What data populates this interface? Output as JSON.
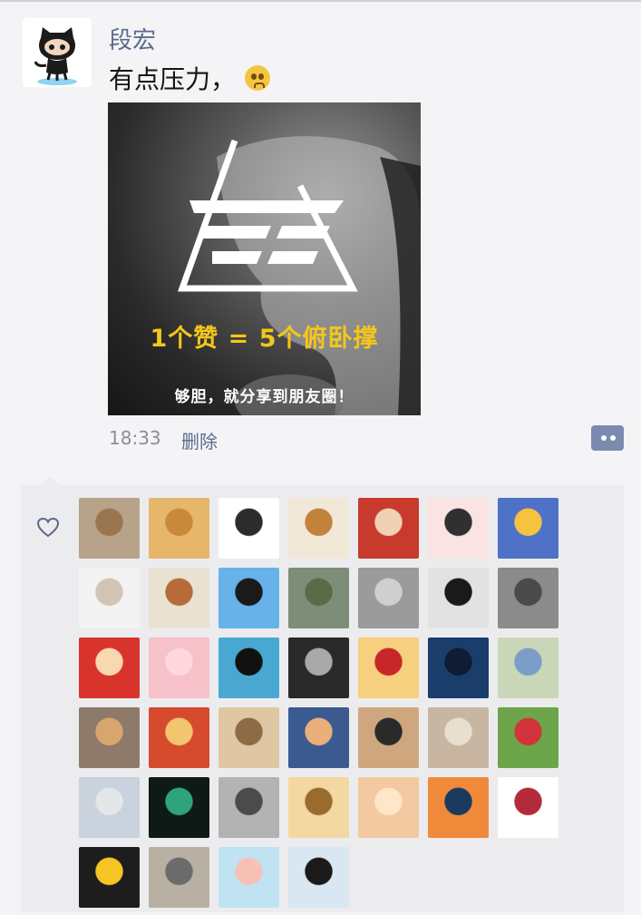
{
  "post": {
    "author": "段宏",
    "text": "有点压力，",
    "image": {
      "headline": "1个赞 = 5个俯卧撑",
      "caption": "够胆，就分享到朋友圈！"
    },
    "time": "18:33",
    "delete_label": "删除"
  },
  "likes": {
    "count": 40,
    "avatars": [
      [
        "#b7a28a",
        "#9a7650"
      ],
      [
        "#e6b66a",
        "#c9893b"
      ],
      [
        "#ffffff",
        "#2c2c2c"
      ],
      [
        "#f2e8d8",
        "#c1823c"
      ],
      [
        "#c83a2c",
        "#f0d1b5"
      ],
      [
        "#fbe3e3",
        "#303030"
      ],
      [
        "#4d72c8",
        "#f6c23f"
      ],
      [
        "#f3f3f3",
        "#d3c4b5"
      ],
      [
        "#e9e2d1",
        "#b86a3b"
      ],
      [
        "#67b2e8",
        "#1a1a1a"
      ],
      [
        "#7e8d78",
        "#5a6b48"
      ],
      [
        "#9b9b9b",
        "#cfcfcf"
      ],
      [
        "#e2e2e2",
        "#1a1a1a"
      ],
      [
        "#8b8b8b",
        "#4a4a4a"
      ],
      [
        "#d8342c",
        "#f7d8b0"
      ],
      [
        "#f6c1c8",
        "#ffd7dc"
      ],
      [
        "#48a8d2",
        "#111111"
      ],
      [
        "#2a2a2a",
        "#a9a9a9"
      ],
      [
        "#f6cf7f",
        "#c7262a"
      ],
      [
        "#1a3d6c",
        "#0f1c33"
      ],
      [
        "#c9d7b8",
        "#7b9ec9"
      ],
      [
        "#8e7a6a",
        "#d9a56f"
      ],
      [
        "#d64b2e",
        "#f3c56f"
      ],
      [
        "#e0c7a3",
        "#8e6a45"
      ],
      [
        "#3b5a8f",
        "#e9b07a"
      ],
      [
        "#cfa77e",
        "#2a2a2a"
      ],
      [
        "#c8b6a2",
        "#e9dfcf"
      ],
      [
        "#6da54b",
        "#d2343b"
      ],
      [
        "#c9d2dd",
        "#e4e7ea"
      ],
      [
        "#0d1a16",
        "#2fa37a"
      ],
      [
        "#b3b3b3",
        "#4b4b4b"
      ],
      [
        "#f3d8a1",
        "#9a6a2f"
      ],
      [
        "#f3c9a1",
        "#fde7c8"
      ],
      [
        "#f08a3b",
        "#1b3a5f"
      ],
      [
        "#ffffff",
        "#b32b3a"
      ],
      [
        "#1d1d1d",
        "#f6c423"
      ],
      [
        "#b7b0a3",
        "#6b6b6b"
      ],
      [
        "#bfe3f2",
        "#f6c1b5"
      ],
      [
        "#d8e7f1",
        "#1a1a1a"
      ]
    ]
  }
}
